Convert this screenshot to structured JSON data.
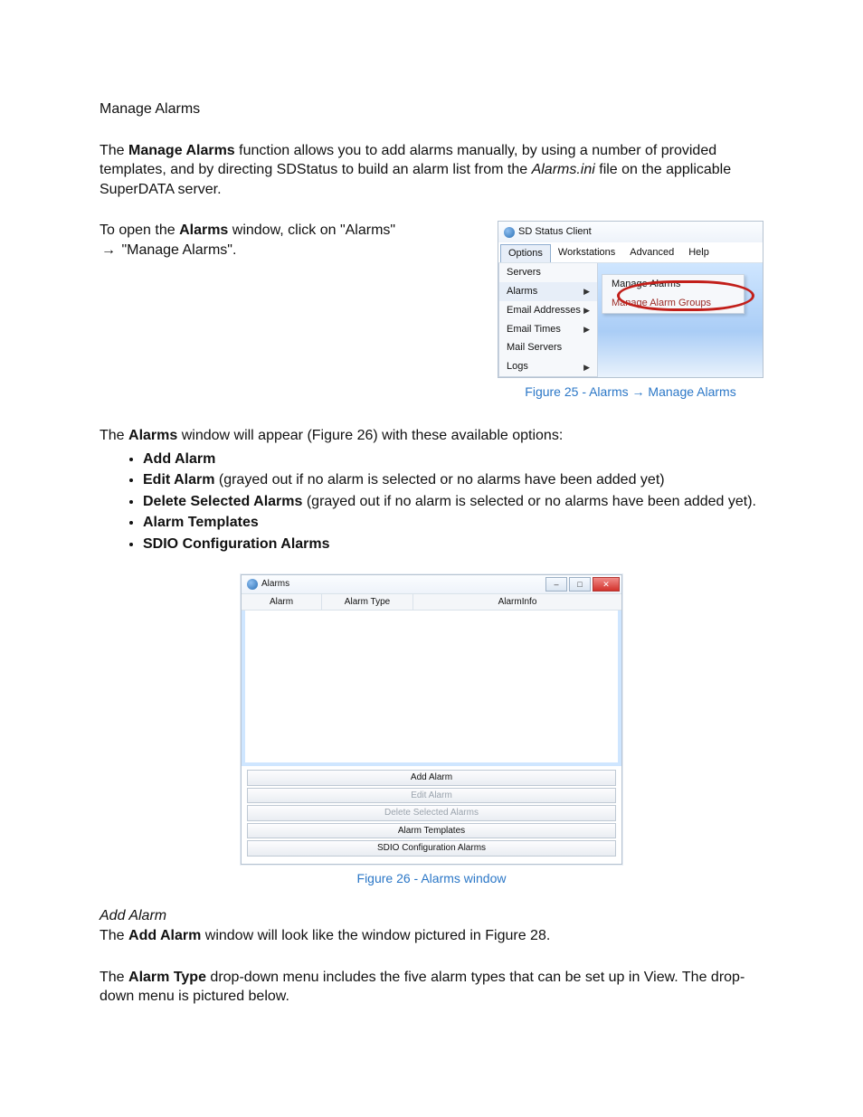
{
  "heading": "Manage Alarms",
  "intro": {
    "pre": "The ",
    "bold": "Manage Alarms",
    "post1": " function allows you to add alarms manually, by using a number of provided templates, and by directing SDStatus to build an alarm list from the ",
    "italic": "Alarms.ini",
    "post2": " file on the applicable SuperDATA server."
  },
  "open_row": {
    "pre": "To open the ",
    "bold": "Alarms",
    "post": " window, click on \"Alarms\" ",
    "arrow": "→",
    "tail": " \"Manage Alarms\"."
  },
  "fig25": {
    "app_title": "SD Status Client",
    "menubar": {
      "options": "Options",
      "workstations": "Workstations",
      "advanced": "Advanced",
      "help": "Help"
    },
    "dropdown": {
      "servers": "Servers",
      "alarms": "Alarms",
      "email_addresses": "Email Addresses",
      "email_times": "Email Times",
      "mail_servers": "Mail Servers",
      "logs": "Logs"
    },
    "submenu": {
      "manage_alarms": "Manage Alarms",
      "manage_alarm_groups": "Manage Alarm Groups"
    },
    "caption_pre": "Figure 25 - Alarms ",
    "caption_arrow": "→",
    "caption_post": " Manage Alarms"
  },
  "options_intro": {
    "pre": "The ",
    "bold": "Alarms",
    "post": " window will appear (Figure 26) with these available options:"
  },
  "options": {
    "add_alarm": "Add Alarm",
    "edit_alarm_bold": "Edit Alarm",
    "edit_alarm_tail": " (grayed out if no alarm is selected or no alarms have been added yet)",
    "delete_bold": "Delete Selected Alarms",
    "delete_tail": " (grayed out if no alarm is selected or no alarms have been added yet).",
    "alarm_templates": "Alarm Templates",
    "sdio_cfg": "SDIO Configuration Alarms"
  },
  "fig26": {
    "title": "Alarms",
    "cols": {
      "alarm": "Alarm",
      "type": "Alarm Type",
      "info": "AlarmInfo"
    },
    "buttons": {
      "add": "Add Alarm",
      "edit": "Edit Alarm",
      "delete": "Delete Selected Alarms",
      "templates": "Alarm Templates",
      "sdio": "SDIO Configuration Alarms"
    },
    "winbtns": {
      "min": "–",
      "max": "□",
      "close": "✕"
    },
    "caption": "Figure 26 - Alarms window"
  },
  "add_alarm_heading": "Add Alarm",
  "add_alarm_para": {
    "pre": "The ",
    "bold": "Add Alarm",
    "post": " window will look like the window pictured in Figure 28."
  },
  "alarm_type_para": {
    "pre": "The ",
    "bold": "Alarm Type",
    "post": " drop-down menu includes the five alarm types that can be set up in View. The drop-down menu is pictured below."
  }
}
